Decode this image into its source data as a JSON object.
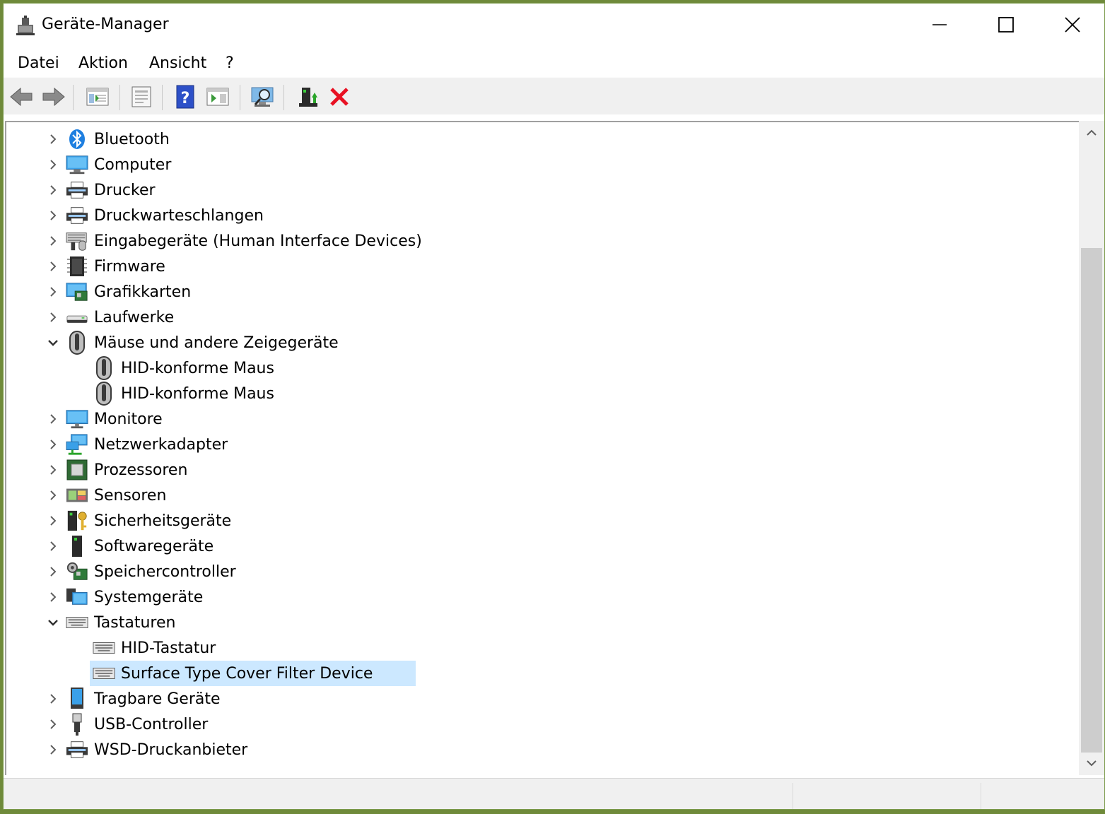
{
  "window": {
    "title": "Geräte-Manager",
    "icon": "device-manager-icon"
  },
  "menu": {
    "items": [
      {
        "label": "Datei"
      },
      {
        "label": "Aktion"
      },
      {
        "label": "Ansicht"
      },
      {
        "label": "?"
      }
    ]
  },
  "toolbar": {
    "buttons": [
      "back-arrow-icon",
      "forward-arrow-icon",
      "tree-view-icon",
      "properties-icon",
      "help-icon",
      "run-icon",
      "scan-hardware-icon",
      "update-driver-icon",
      "uninstall-icon"
    ]
  },
  "tree": {
    "nodes": [
      {
        "label": "Bluetooth",
        "icon": "bluetooth-icon",
        "level": 0,
        "state": "collapsed"
      },
      {
        "label": "Computer",
        "icon": "computer-icon",
        "level": 0,
        "state": "collapsed"
      },
      {
        "label": "Drucker",
        "icon": "printer-icon",
        "level": 0,
        "state": "collapsed"
      },
      {
        "label": "Druckwarteschlangen",
        "icon": "printer-icon",
        "level": 0,
        "state": "collapsed"
      },
      {
        "label": "Eingabegeräte (Human Interface Devices)",
        "icon": "hid-icon",
        "level": 0,
        "state": "collapsed"
      },
      {
        "label": "Firmware",
        "icon": "chip-icon",
        "level": 0,
        "state": "collapsed"
      },
      {
        "label": "Grafikkarten",
        "icon": "display-adapter-icon",
        "level": 0,
        "state": "collapsed"
      },
      {
        "label": "Laufwerke",
        "icon": "drive-icon",
        "level": 0,
        "state": "collapsed"
      },
      {
        "label": "Mäuse und andere Zeigegeräte",
        "icon": "mouse-icon",
        "level": 0,
        "state": "expanded"
      },
      {
        "label": "HID-konforme Maus",
        "icon": "mouse-icon",
        "level": 1,
        "state": "leaf"
      },
      {
        "label": "HID-konforme Maus",
        "icon": "mouse-icon",
        "level": 1,
        "state": "leaf"
      },
      {
        "label": "Monitore",
        "icon": "monitor-icon",
        "level": 0,
        "state": "collapsed"
      },
      {
        "label": "Netzwerkadapter",
        "icon": "network-icon",
        "level": 0,
        "state": "collapsed"
      },
      {
        "label": "Prozessoren",
        "icon": "processor-icon",
        "level": 0,
        "state": "collapsed"
      },
      {
        "label": "Sensoren",
        "icon": "sensor-icon",
        "level": 0,
        "state": "collapsed"
      },
      {
        "label": "Sicherheitsgeräte",
        "icon": "security-key-icon",
        "level": 0,
        "state": "collapsed"
      },
      {
        "label": "Softwaregeräte",
        "icon": "software-device-icon",
        "level": 0,
        "state": "collapsed"
      },
      {
        "label": "Speichercontroller",
        "icon": "storage-controller-icon",
        "level": 0,
        "state": "collapsed"
      },
      {
        "label": "Systemgeräte",
        "icon": "system-device-icon",
        "level": 0,
        "state": "collapsed"
      },
      {
        "label": "Tastaturen",
        "icon": "keyboard-icon",
        "level": 0,
        "state": "expanded"
      },
      {
        "label": "HID-Tastatur",
        "icon": "keyboard-icon",
        "level": 1,
        "state": "leaf"
      },
      {
        "label": "Surface Type Cover Filter Device",
        "icon": "keyboard-icon",
        "level": 1,
        "state": "leaf",
        "selected": true
      },
      {
        "label": "Tragbare Geräte",
        "icon": "portable-device-icon",
        "level": 0,
        "state": "collapsed"
      },
      {
        "label": "USB-Controller",
        "icon": "usb-icon",
        "level": 0,
        "state": "collapsed"
      },
      {
        "label": "WSD-Druckanbieter",
        "icon": "printer-icon",
        "level": 0,
        "state": "collapsed"
      }
    ]
  },
  "colors": {
    "selection": "#cce8ff",
    "uninstall_red": "#e81123",
    "help_blue": "#2d50c8"
  }
}
